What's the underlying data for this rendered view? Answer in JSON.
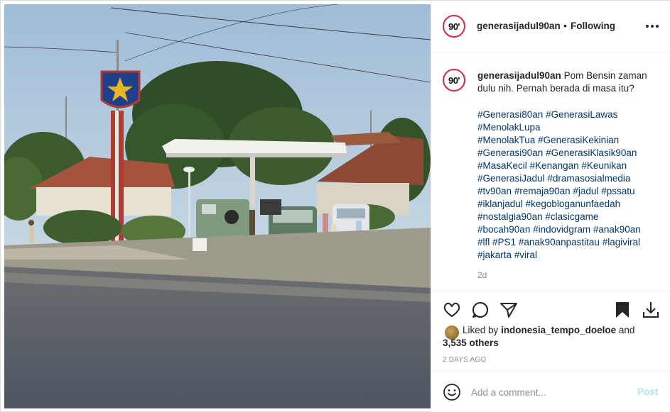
{
  "post": {
    "username": "generasijadul90an",
    "avatar_text": "90'",
    "separator": "•",
    "follow_status": "Following",
    "caption_text": "Pom Bensin zaman dulu nih. Pernah berada di masa itu?",
    "hashtags": [
      "#Generasi80an",
      "#GenerasiLawas",
      "#MenolakLupa",
      "#MenolakTua",
      "#GenerasiKekinian",
      "#Generasi90an",
      "#GenerasiKlasik90an",
      "#MasaKecil",
      "#Kenangan",
      "#Keunikan",
      "#GenerasiJadul",
      "#dramasosialmedia",
      "#tv90an",
      "#remaja90an",
      "#jadul",
      "#pssatu",
      "#iklanjadul",
      "#kegobloganunfaedah",
      "#nostalgia90an",
      "#clasicgame",
      "#bocah90an",
      "#indovidgram",
      "#anak90an",
      "#lfl",
      "#PS1",
      "#anak90anpastitau",
      "#lagiviral",
      "#jakarta",
      "#viral"
    ],
    "hashtag_lines": [
      [
        "#Generasi80an",
        "#GenerasiLawas"
      ],
      [
        "#MenolakLupa"
      ],
      [
        "#MenolakTua",
        "#GenerasiKekinian"
      ],
      [
        "#Generasi90an",
        "#GenerasiKlasik90an"
      ],
      [
        "#MasaKecil",
        "#Kenangan",
        "#Keunikan"
      ],
      [
        "#GenerasiJadul",
        "#dramasosialmedia"
      ],
      [
        "#tv90an",
        "#remaja90an",
        "#jadul",
        "#pssatu"
      ],
      [
        "#iklanjadul",
        "#kegobloganunfaedah"
      ],
      [
        "#nostalgia90an",
        "#clasicgame"
      ],
      [
        "#bocah90an",
        "#indovidgram",
        "#anak90an"
      ],
      [
        "#lfl",
        "#PS1",
        "#anak90anpastitau",
        "#lagiviral"
      ],
      [
        "#jakarta",
        "#viral"
      ]
    ],
    "caption_age": "2d",
    "liked_by_prefix": "Liked by",
    "liked_by_user": "indonesia_tempo_doeloe",
    "liked_by_and": "and",
    "liked_by_others": "3,535 others",
    "post_age": "2 DAYS AGO"
  },
  "comment_box": {
    "placeholder": "Add a comment...",
    "post_label": "Post"
  },
  "icons": {
    "more": "more-options-icon",
    "like": "heart-icon",
    "comment": "comment-bubble-icon",
    "share": "paper-plane-icon",
    "save": "bookmark-filled-icon",
    "download": "download-icon",
    "emoji": "smiley-icon"
  },
  "colors": {
    "text": "#262626",
    "hashtag": "#00376b",
    "muted": "#8e8e8e",
    "post_button_disabled": "#b2dffc",
    "avatar_ring": "#d6264b",
    "border": "#dbdbdb"
  }
}
